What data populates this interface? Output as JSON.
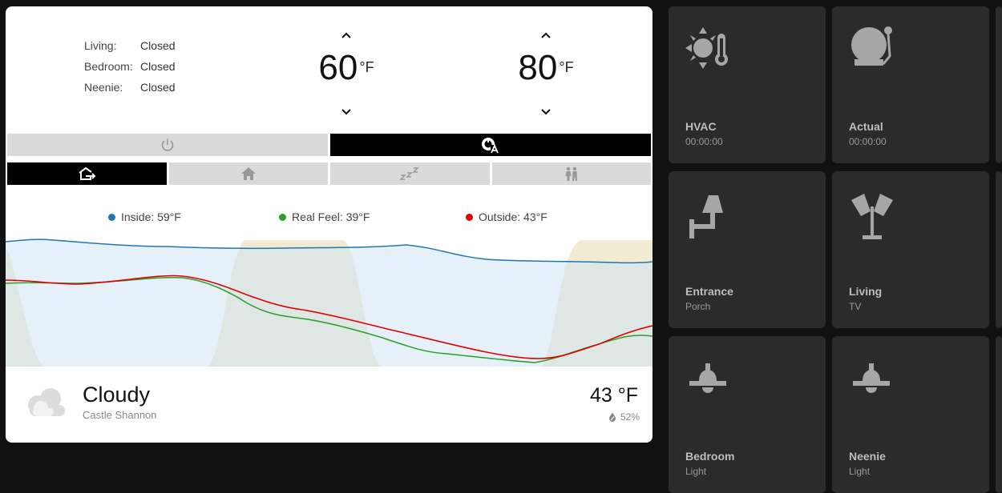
{
  "rooms": [
    {
      "name": "Living:",
      "state": "Closed"
    },
    {
      "name": "Bedroom:",
      "state": "Closed"
    },
    {
      "name": "Neenie:",
      "state": "Closed"
    }
  ],
  "setpoints": {
    "low": {
      "value": "60",
      "unit": "°F"
    },
    "high": {
      "value": "80",
      "unit": "°F"
    }
  },
  "legend": {
    "inside": "Inside: 59°F",
    "real_feel": "Real Feel: 39°F",
    "outside": "Outside: 43°F"
  },
  "colors": {
    "inside": "#1f77b4",
    "real_feel": "#2ca02c",
    "outside": "#e00000",
    "tile_bg": "#2b2b2b",
    "tile_icon": "#a6a6a6"
  },
  "weather": {
    "condition": "Cloudy",
    "location": "Castle Shannon",
    "temperature": "43 °F",
    "humidity": "52%"
  },
  "tiles": [
    {
      "title": "HVAC",
      "sub": "00:00:00",
      "icon": "sun-thermometer-icon"
    },
    {
      "title": "Actual",
      "sub": "00:00:00",
      "icon": "bell-icon"
    },
    {
      "title": "Entrance",
      "sub": "Porch",
      "icon": "wall-lamp-icon"
    },
    {
      "title": "Living",
      "sub": "TV",
      "icon": "floor-lamp-icon"
    },
    {
      "title": "Bedroom",
      "sub": "Light",
      "icon": "ceiling-light-icon"
    },
    {
      "title": "Neenie",
      "sub": "Light",
      "icon": "ceiling-light-icon"
    }
  ]
}
